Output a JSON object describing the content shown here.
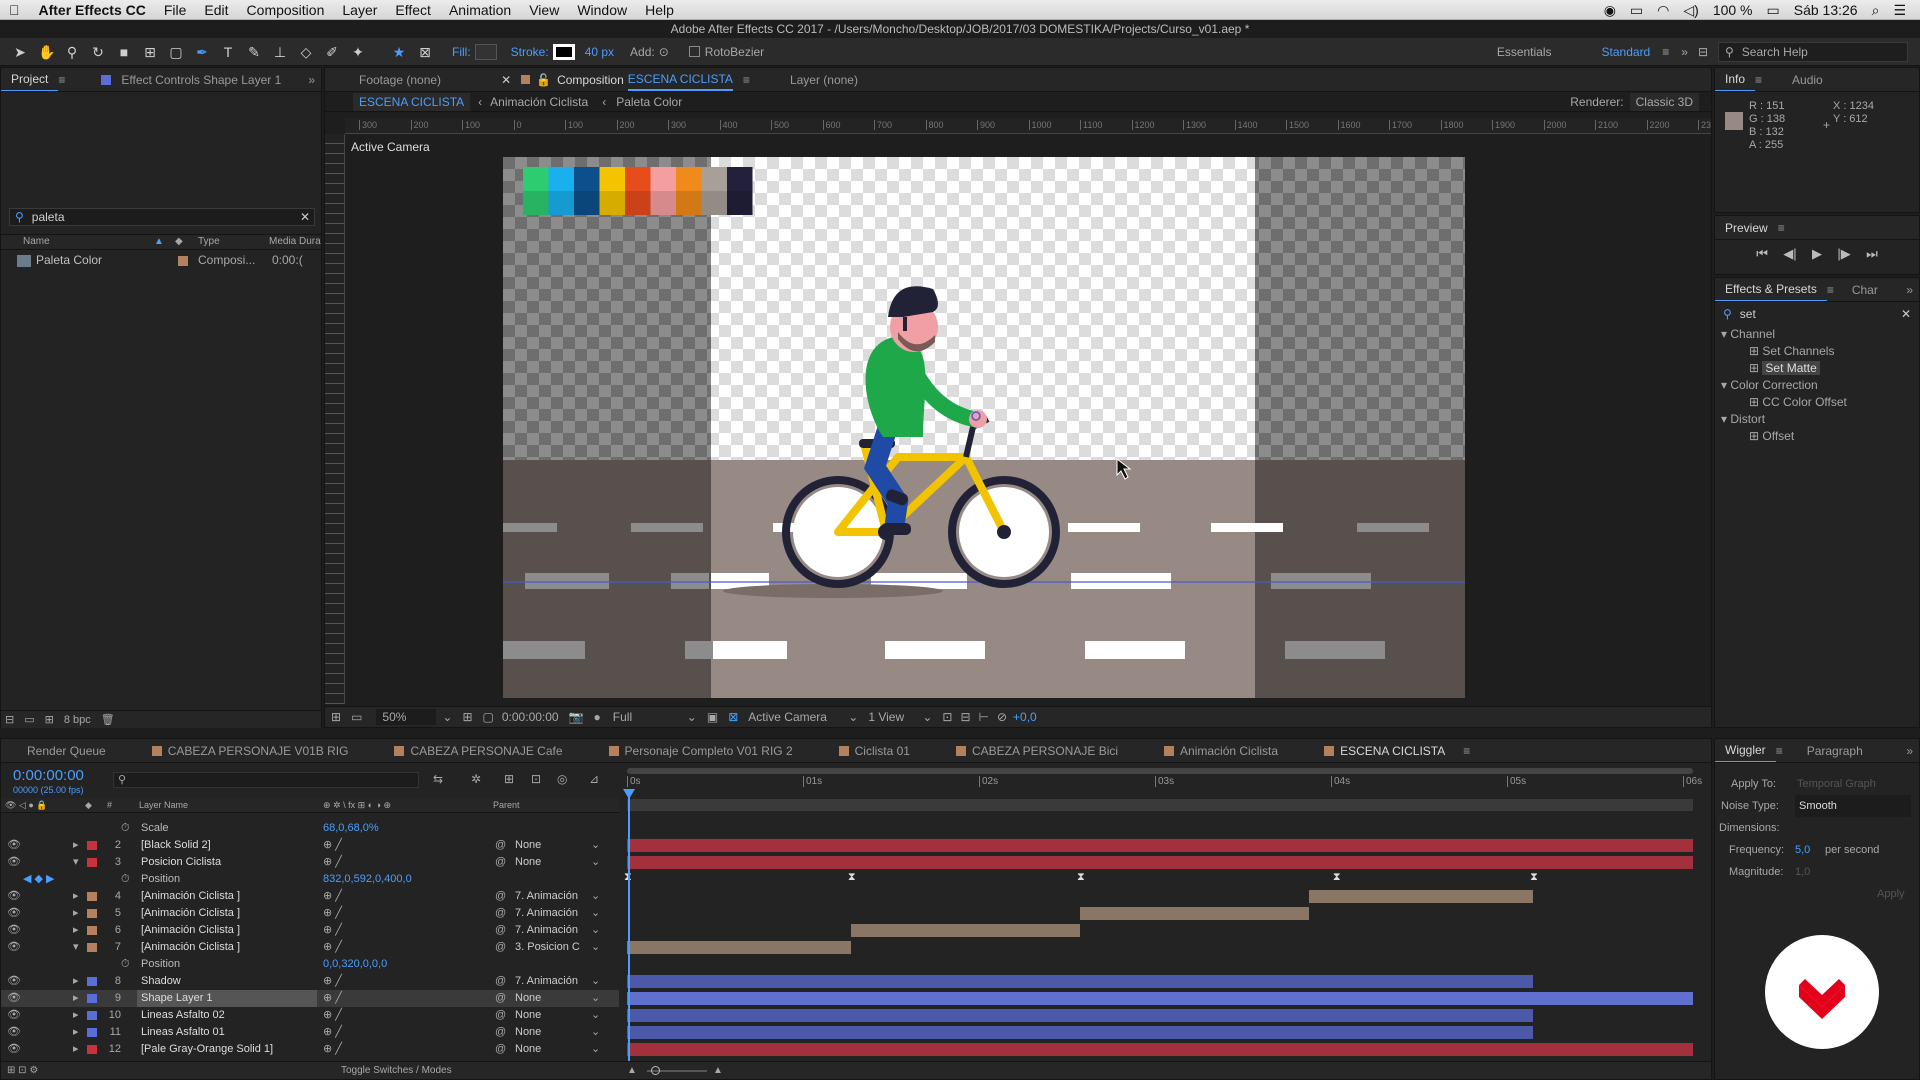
{
  "menubar": {
    "app": "After Effects CC",
    "items": [
      "File",
      "Edit",
      "Composition",
      "Layer",
      "Effect",
      "Animation",
      "View",
      "Window",
      "Help"
    ],
    "battery": "100 %",
    "clock": "Sáb 13:26"
  },
  "window": {
    "title": "Adobe After Effects CC 2017 - /Users/Moncho/Desktop/JOB/2017/03 DOMESTIKA/Projects/Curso_v01.aep *"
  },
  "toolbar": {
    "fill_label": "Fill:",
    "stroke_label": "Stroke:",
    "stroke_width": "40 px",
    "add_label": "Add:",
    "rotobezier": "RotoBezier",
    "workspace_essentials": "Essentials",
    "workspace_standard": "Standard",
    "search_help": "Search Help"
  },
  "project": {
    "tab": "Project",
    "effect_controls": "Effect Controls Shape Layer 1",
    "search": "paleta",
    "col_name": "Name",
    "col_type": "Type",
    "col_media": "Media Dura",
    "item_name": "Paleta Color",
    "item_type": "Composi...",
    "item_dur": "0:00:("
  },
  "comp_tabs": {
    "footage": "Footage (none)",
    "composition_prefix": "Composition",
    "composition_name": "ESCENA CICLISTA",
    "layer": "Layer (none)"
  },
  "comp_breadcrumb": [
    "ESCENA CICLISTA",
    "Animación Ciclista",
    "Paleta Color"
  ],
  "renderer": {
    "label": "Renderer:",
    "value": "Classic 3D"
  },
  "viewer": {
    "camera_label": "Active Camera",
    "ruler_ticks": [
      "300",
      "200",
      "100",
      "0",
      "100",
      "200",
      "300",
      "400",
      "500",
      "600",
      "700",
      "800",
      "900",
      "1000",
      "1100",
      "1200",
      "1300",
      "1400",
      "1500",
      "1600",
      "1700",
      "1800",
      "1900",
      "2000",
      "2100",
      "2200",
      "2300"
    ],
    "palette": [
      "#2ecc71",
      "#1ab0ef",
      "#0d4f8b",
      "#f5c400",
      "#e74c1c",
      "#f49ea0",
      "#f08a1a",
      "#a89f98",
      "#22203a"
    ],
    "footer": {
      "bpc": "8 bpc",
      "zoom": "50%",
      "timecode": "0:00:00:00",
      "resolution": "Full",
      "view": "Active Camera",
      "views": "1 View",
      "exposure": "+0,0"
    }
  },
  "info": {
    "tab": "Info",
    "audio": "Audio",
    "r": "R : 151",
    "g": "G : 138",
    "b": "B : 132",
    "a": "A : 255",
    "x": "X : 1234",
    "y": "Y : 612",
    "swatch": "#978a84"
  },
  "preview": {
    "tab": "Preview"
  },
  "effects": {
    "tab": "Effects & Presets",
    "char": "Char",
    "search": "set",
    "groups": [
      {
        "name": "Channel",
        "items": [
          "Set Channels",
          "Set Matte"
        ]
      },
      {
        "name": "Color Correction",
        "items": [
          "CC Color Offset"
        ]
      },
      {
        "name": "Distort",
        "items": [
          "Offset"
        ]
      }
    ]
  },
  "timeline": {
    "tabs": [
      "Render Queue",
      "CABEZA PERSONAJE V01B RIG",
      "CABEZA PERSONAJE Cafe",
      "Personaje Completo V01 RIG 2",
      "Ciclista 01",
      "CABEZA PERSONAJE Bici",
      "Animación Ciclista",
      "ESCENA CICLISTA"
    ],
    "timecode": "0:00:00:00",
    "fps": "00000 (25.00 fps)",
    "col_layer": "Layer Name",
    "col_parent": "Parent",
    "ticks": [
      "0s",
      "01s",
      "02s",
      "03s",
      "04s",
      "05s",
      "06s"
    ],
    "rows": [
      {
        "kind": "prop",
        "name": "Scale",
        "value": "68,0,68,0%"
      },
      {
        "kind": "layer",
        "num": "2",
        "color": "#c8323a",
        "name": "[Black Solid 2]",
        "parent": "None",
        "bar": "#a3303d",
        "bs": 0,
        "be": 1
      },
      {
        "kind": "layer",
        "num": "3",
        "color": "#c8323a",
        "name": "Posicion Ciclista",
        "parent": "None",
        "bar": "#a3303d",
        "bs": 0,
        "be": 1,
        "open": true
      },
      {
        "kind": "prop",
        "name": "Position",
        "value": "832,0,592,0,400,0",
        "keys": true
      },
      {
        "kind": "layer",
        "num": "4",
        "color": "#b4805e",
        "name": "[Animación Ciclista ]",
        "parent": "7. Animación",
        "bar": "#8a7665",
        "bs": 0.64,
        "be": 0.85
      },
      {
        "kind": "layer",
        "num": "5",
        "color": "#b4805e",
        "name": "[Animación Ciclista ]",
        "parent": "7. Animación",
        "bar": "#8a7665",
        "bs": 0.425,
        "be": 0.64
      },
      {
        "kind": "layer",
        "num": "6",
        "color": "#b4805e",
        "name": "[Animación Ciclista ]",
        "parent": "7. Animación",
        "bar": "#8a7665",
        "bs": 0.21,
        "be": 0.425
      },
      {
        "kind": "layer",
        "num": "7",
        "color": "#b4805e",
        "name": "[Animación Ciclista ]",
        "parent": "3. Posicion C",
        "bar": "#8a7665",
        "bs": 0,
        "be": 0.21,
        "open": true
      },
      {
        "kind": "prop",
        "name": "Position",
        "value": "0,0,320,0,0,0"
      },
      {
        "kind": "layer",
        "num": "8",
        "color": "#5b6ed8",
        "name": "Shadow",
        "parent": "7. Animación",
        "bar": "#4c59a9",
        "bs": 0,
        "be": 0.85
      },
      {
        "kind": "layer",
        "num": "9",
        "color": "#5b6ed8",
        "name": "Shape Layer 1",
        "parent": "None",
        "bar": "#5f70cf",
        "bs": 0,
        "be": 1,
        "selected": true
      },
      {
        "kind": "layer",
        "num": "10",
        "color": "#5b6ed8",
        "name": "Lineas Asfalto 02",
        "parent": "None",
        "bar": "#4c59a9",
        "bs": 0,
        "be": 0.85
      },
      {
        "kind": "layer",
        "num": "11",
        "color": "#5b6ed8",
        "name": "Lineas Asfalto 01",
        "parent": "None",
        "bar": "#4c59a9",
        "bs": 0,
        "be": 0.85
      },
      {
        "kind": "layer",
        "num": "12",
        "color": "#c8323a",
        "name": "[Pale Gray-Orange Solid 1]",
        "parent": "None",
        "bar": "#a3303d",
        "bs": 0,
        "be": 1
      }
    ],
    "toggle": "Toggle Switches / Modes"
  },
  "wiggler": {
    "tab": "Wiggler",
    "paragraph": "Paragraph",
    "apply_to_label": "Apply To:",
    "apply_to": "Temporal Graph",
    "noise_label": "Noise Type:",
    "noise": "Smooth",
    "dimensions_label": "Dimensions:",
    "frequency_label": "Frequency:",
    "frequency": "5,0",
    "frequency_unit": "per second",
    "magnitude_label": "Magnitude:",
    "magnitude": "1,0",
    "apply": "Apply"
  }
}
